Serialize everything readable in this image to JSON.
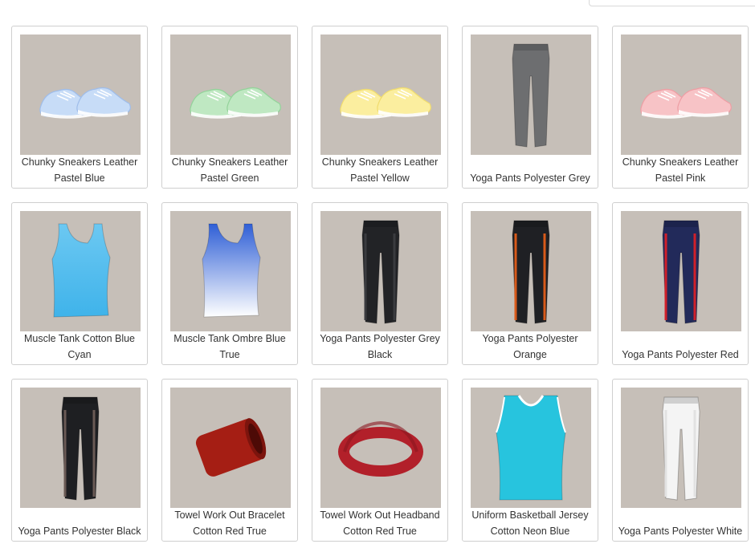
{
  "products": [
    {
      "name": "Chunky Sneakers Leather Pastel Blue",
      "icon": "sneakers-icon",
      "color": "#c7dcf7",
      "accent": "#9fbdea"
    },
    {
      "name": "Chunky Sneakers Leather Pastel Green",
      "icon": "sneakers-icon",
      "color": "#bfe8c2",
      "accent": "#93d39a"
    },
    {
      "name": "Chunky Sneakers Leather Pastel Yellow",
      "icon": "sneakers-icon",
      "color": "#fbee9f",
      "accent": "#f1dc6e"
    },
    {
      "name": "Yoga Pants Polyester Grey",
      "icon": "pants-icon",
      "color": "#6d6e70",
      "accent": "#6d6e70"
    },
    {
      "name": "Chunky Sneakers Leather Pastel Pink",
      "icon": "sneakers-icon",
      "color": "#f7c3c6",
      "accent": "#ee9ea4"
    },
    {
      "name": "Muscle Tank Cotton Blue Cyan",
      "icon": "tank-top-icon",
      "color": "#6cc8f2",
      "accent": "#3fb3ea"
    },
    {
      "name": "Muscle Tank Ombre Blue True",
      "icon": "tank-top-icon",
      "color": "#2f5fd6",
      "accent": "#ffffff"
    },
    {
      "name": "Yoga Pants Polyester Grey Black",
      "icon": "pants-icon",
      "color": "#222326",
      "accent": "#3a3b3f"
    },
    {
      "name": "Yoga Pants Polyester Orange",
      "icon": "pants-icon",
      "color": "#1f2024",
      "accent": "#d85a1a"
    },
    {
      "name": "Yoga Pants Polyester Red",
      "icon": "pants-icon",
      "color": "#222a5a",
      "accent": "#d0202a"
    },
    {
      "name": "Yoga Pants Polyester Black",
      "icon": "pants-icon",
      "color": "#1e1f22",
      "accent": "#6a5a55"
    },
    {
      "name": "Towel Work Out Bracelet Cotton Red True",
      "icon": "wristband-icon",
      "color": "#a51e14",
      "accent": "#7c140d"
    },
    {
      "name": "Towel Work Out Headband Cotton Red True",
      "icon": "headband-icon",
      "color": "#b2202a",
      "accent": "#8b1820"
    },
    {
      "name": "Uniform Basketball Jersey Cotton Neon Blue",
      "icon": "jersey-icon",
      "color": "#27c4de",
      "accent": "#ffffff"
    },
    {
      "name": "Yoga Pants Polyester White",
      "icon": "pants-icon",
      "color": "#f4f4f4",
      "accent": "#e2e2e2"
    }
  ]
}
